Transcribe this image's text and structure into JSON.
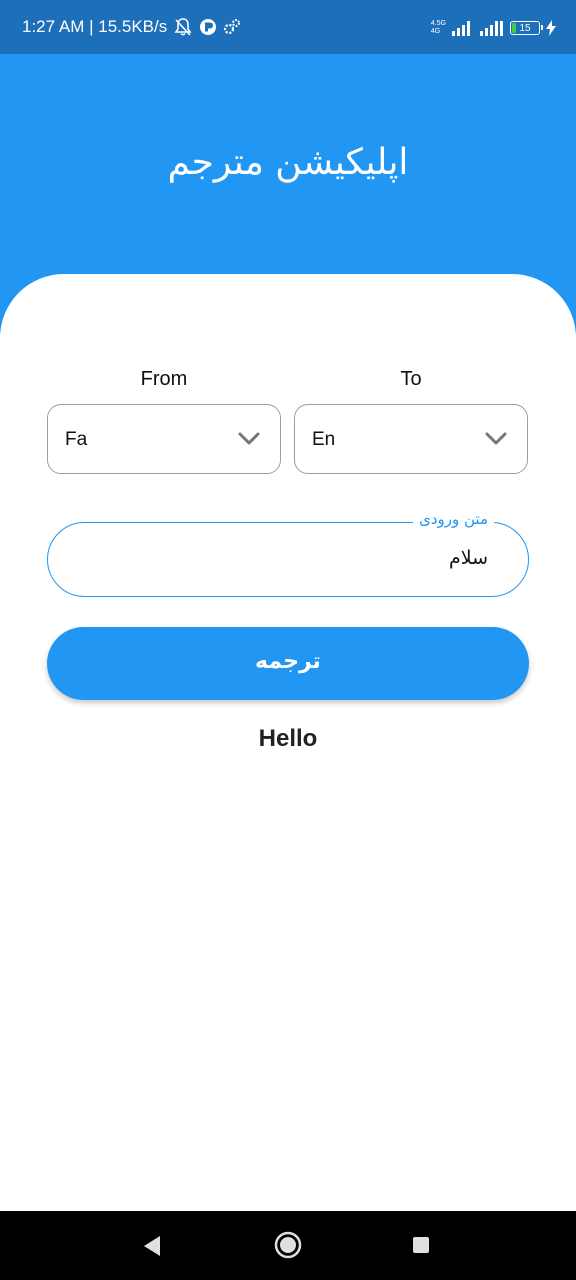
{
  "status_bar": {
    "time_speed": "1:27 AM | 15.5KB/s",
    "network_label_top": "4.5G",
    "network_label_bottom": "4G",
    "battery_level": "15",
    "battery_color": "#3ecf4a"
  },
  "header": {
    "title": "اپلیکیشن مترجم",
    "background_color": "#2196f3"
  },
  "from": {
    "label": "From",
    "selected": "Fa"
  },
  "to": {
    "label": "To",
    "selected": "En"
  },
  "input": {
    "label": "متن ورودی",
    "value": "سلام"
  },
  "translate_button": {
    "label": "ترجمه"
  },
  "result": {
    "text": "Hello"
  },
  "icons": {
    "dropdown": "chevron-down-icon",
    "nav_back": "back-icon",
    "nav_home": "home-icon",
    "nav_recents": "recents-icon"
  }
}
